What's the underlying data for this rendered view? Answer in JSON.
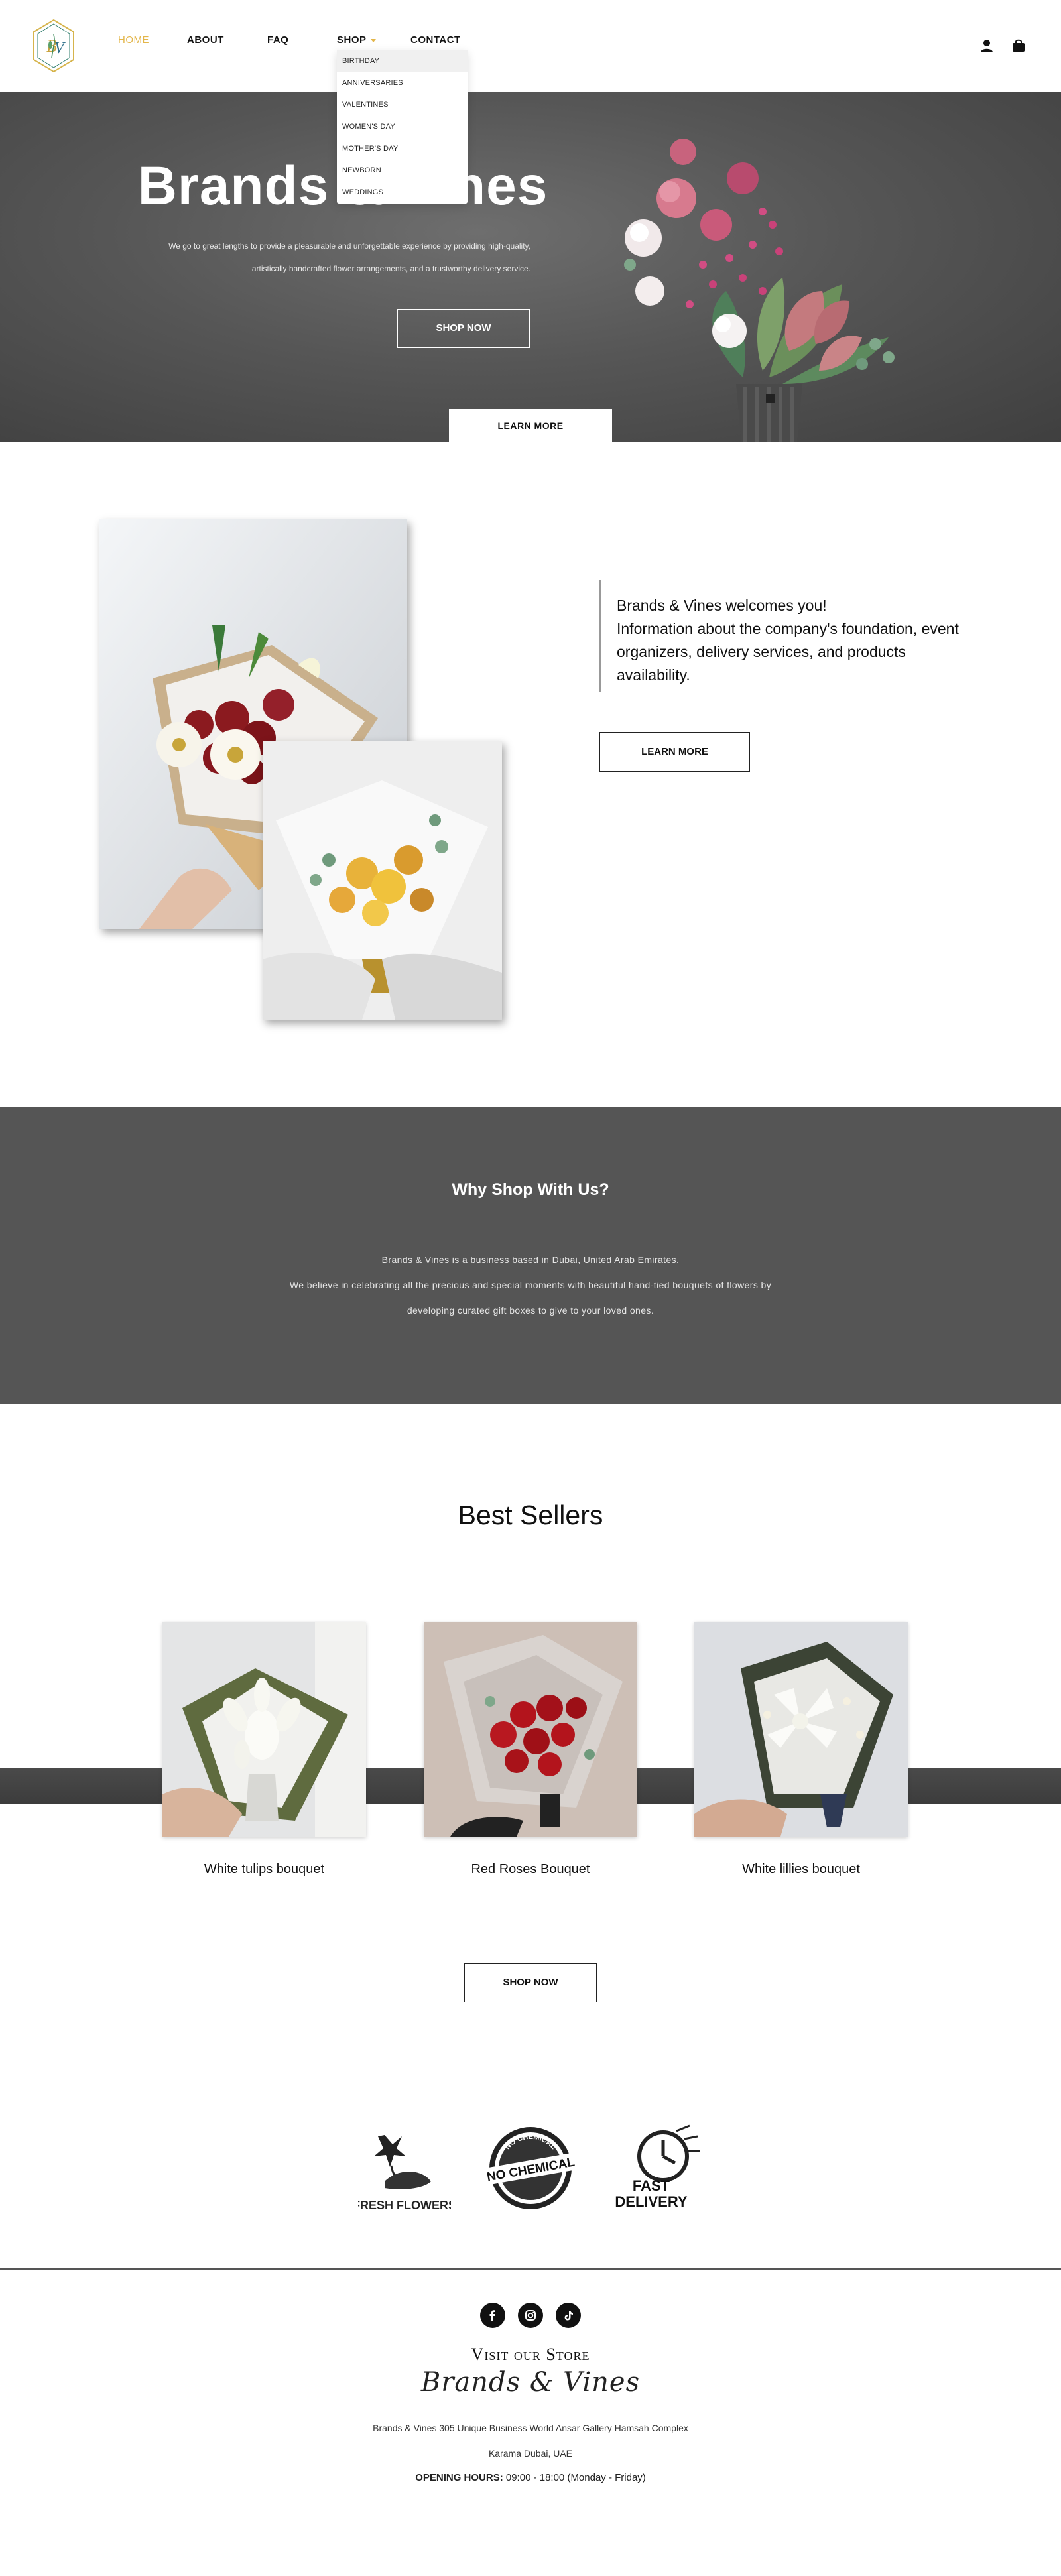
{
  "header": {
    "logo_text": "B&V",
    "nav": [
      {
        "label": "HOME",
        "active": true
      },
      {
        "label": "ABOUT"
      },
      {
        "label": "FAQ"
      },
      {
        "label": "SHOP"
      },
      {
        "label": "CONTACT"
      }
    ],
    "shop_dropdown": [
      "BIRTHDAY",
      "ANNIVERSARIES",
      "VALENTINES",
      "WOMEN'S DAY",
      "MOTHER'S DAY",
      "NEWBORN",
      "WEDDINGS"
    ],
    "icons": [
      "user-icon",
      "shopping-bag-icon"
    ],
    "accent_color": "#e3b64a"
  },
  "hero": {
    "title": "Brands & Vines",
    "subtitle_line1": "We go to great lengths to provide a pleasurable and unforgettable experience by providing high-quality,",
    "subtitle_line2": "artistically handcrafted flower arrangements, and a trustworthy delivery service.",
    "shop_button": "SHOP NOW",
    "learn_button": "LEARN MORE"
  },
  "welcome": {
    "line1": "Brands & Vines welcomes you!",
    "line2": "Information about the company's foundation, event organizers, delivery services, and products availability.",
    "button": "LEARN MORE"
  },
  "why": {
    "title": "Why Shop With Us?",
    "line1": "Brands & Vines is a business based in Dubai, United Arab Emirates.",
    "line2": "We believe in celebrating all the precious and special moments with beautiful hand-tied bouquets of flowers by",
    "line3": "developing curated gift boxes to give to your loved ones.",
    "background": "#555555"
  },
  "best_sellers": {
    "title": "Best Sellers",
    "products": [
      {
        "name": "White tulips bouquet"
      },
      {
        "name": "Red Roses Bouquet"
      },
      {
        "name": "White lillies bouquet"
      }
    ],
    "button": "SHOP NOW"
  },
  "badges": {
    "fresh": "FRESH FLOWERS",
    "chem_ring": "NO CHEMICAL",
    "chem_main": "NO CHEMICAL",
    "fast_top": "FAST",
    "fast_bottom": "DELIVERY"
  },
  "footer": {
    "social": [
      "facebook-icon",
      "instagram-icon",
      "tiktok-icon"
    ],
    "visit_title": "Visit our Store",
    "script_name": "Brands & Vines",
    "address_line1": "Brands & Vines 305 Unique Business World Ansar Gallery Hamsah Complex",
    "address_line2": "Karama Dubai, UAE",
    "hours_label": "OPENING HOURS:",
    "hours_value": "09:00 - 18:00 (Monday - Friday)"
  }
}
